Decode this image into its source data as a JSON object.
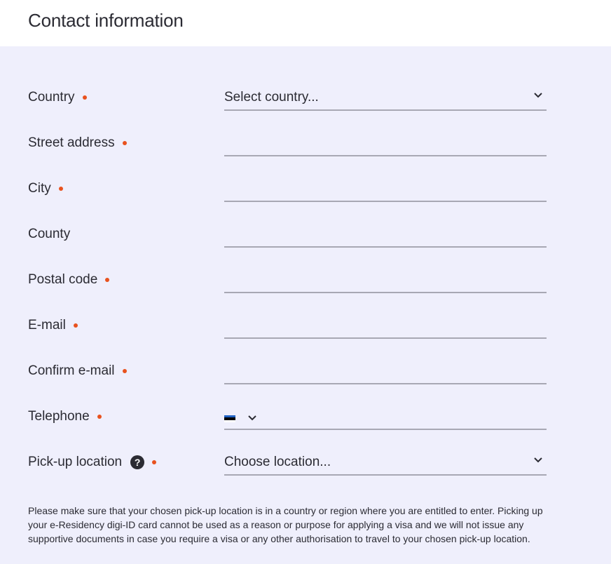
{
  "header": {
    "title": "Contact information"
  },
  "form": {
    "country": {
      "label": "Country",
      "value": "Select country..."
    },
    "street": {
      "label": "Street address",
      "value": ""
    },
    "city": {
      "label": "City",
      "value": ""
    },
    "county": {
      "label": "County",
      "value": ""
    },
    "postal": {
      "label": "Postal code",
      "value": ""
    },
    "email": {
      "label": "E-mail",
      "value": ""
    },
    "confirm_email": {
      "label": "Confirm e-mail",
      "value": ""
    },
    "telephone": {
      "label": "Telephone",
      "value": "",
      "flag_colors": [
        "#1f61c3",
        "#000000",
        "#ffffff"
      ]
    },
    "pickup": {
      "label": "Pick-up location",
      "help": "?",
      "value": "Choose location..."
    }
  },
  "note": "Please make sure that your chosen pick-up location is in a country or region where you are entitled to enter. Picking up your e-Residency digi-ID card cannot be used as a reason or purpose for applying a visa and we will not issue any supportive documents in case you require a visa or any other authorisation to travel to your chosen pick-up location.",
  "colors": {
    "panel_bg": "#efeffc",
    "required_dot": "#e8521e",
    "underline": "#a8a8b4",
    "text": "#2b2b33"
  },
  "icons": {
    "dropdown": "chevron-down-icon",
    "help": "question-circle-icon"
  }
}
